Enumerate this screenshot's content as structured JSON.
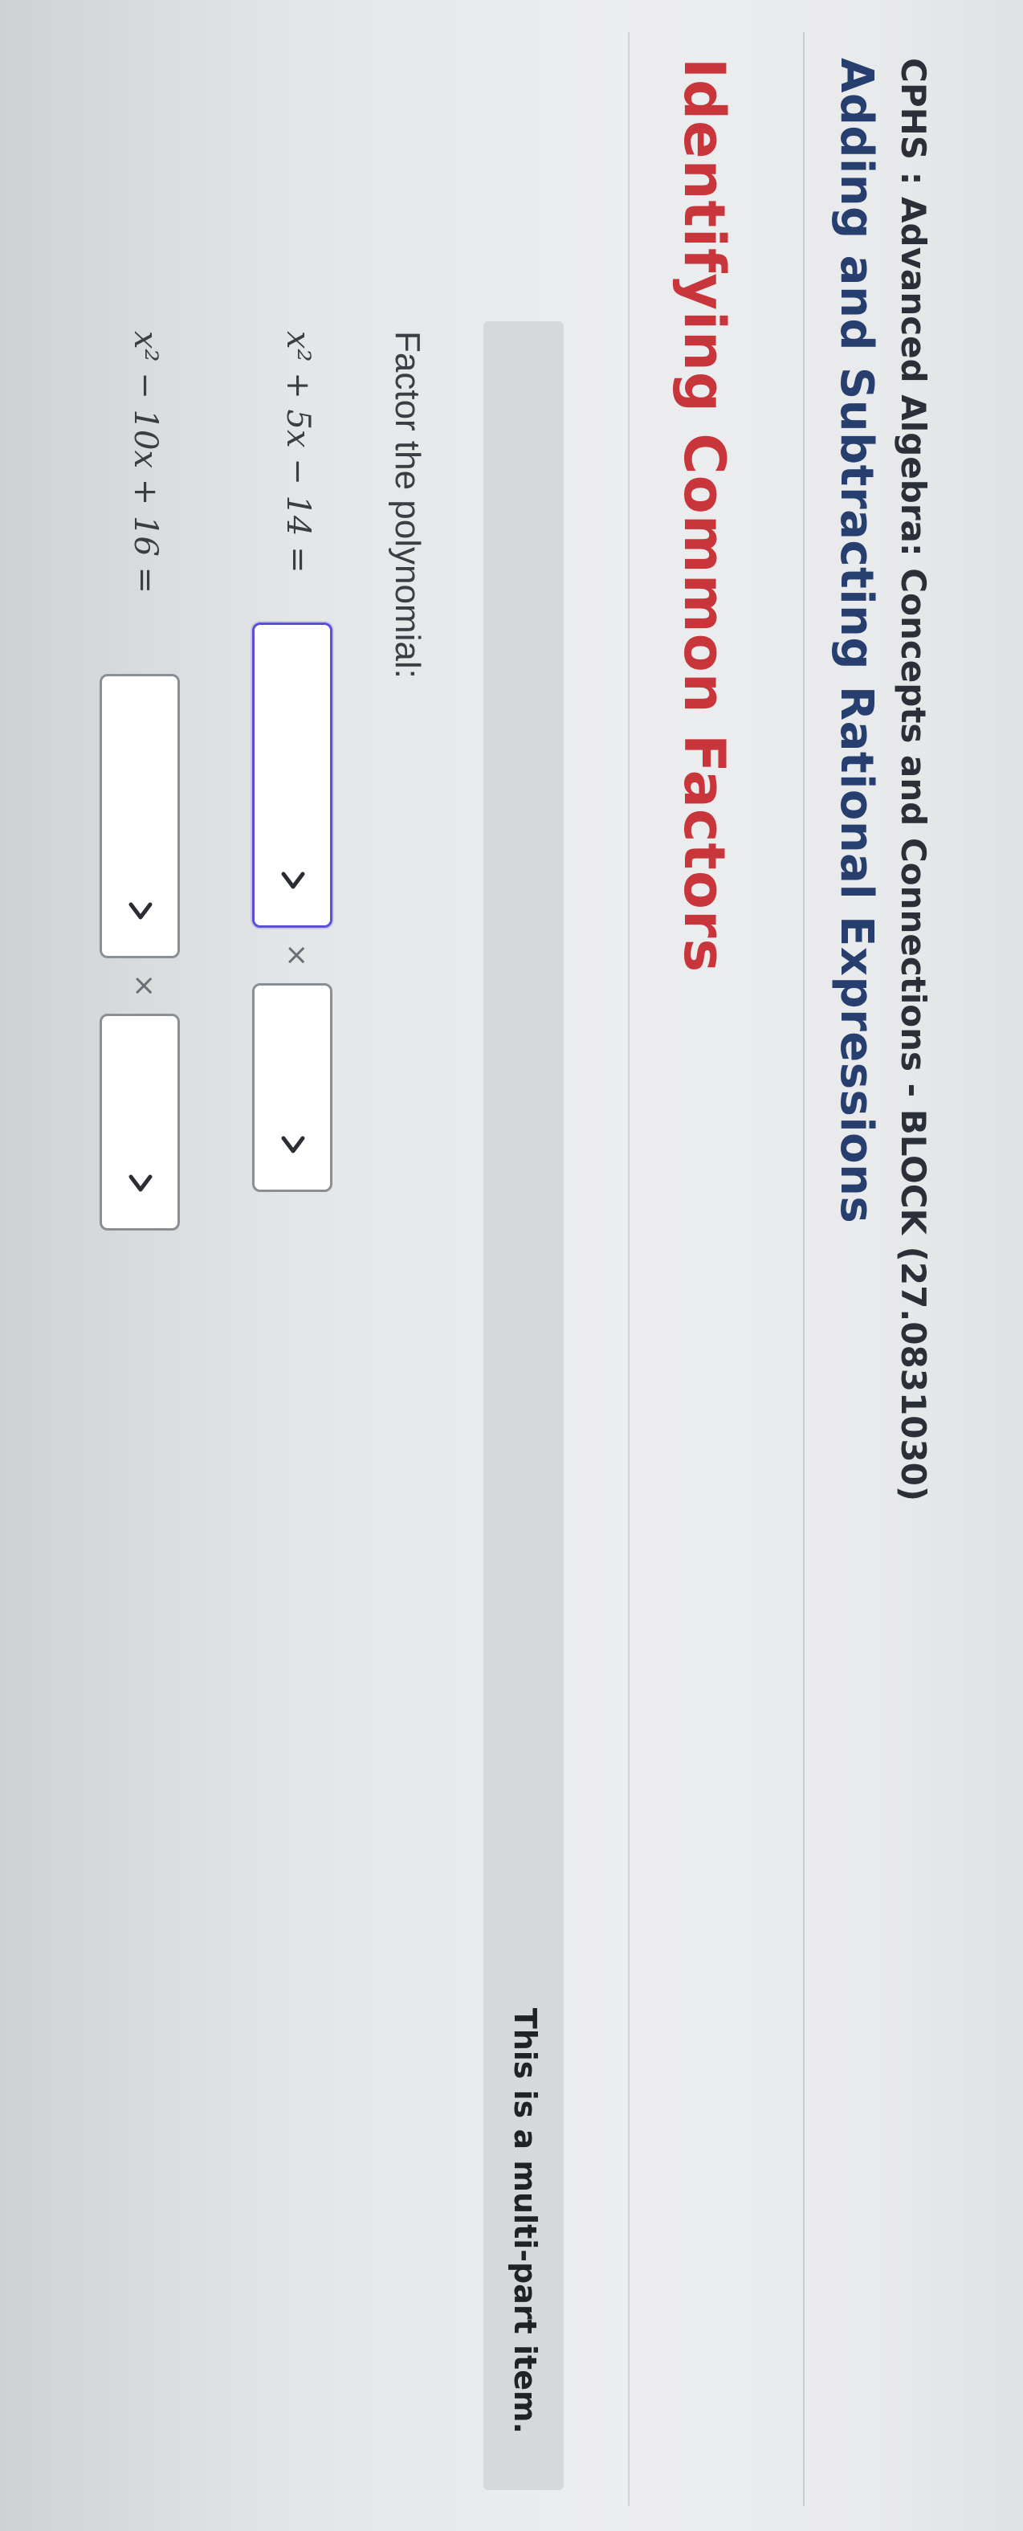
{
  "header": {
    "course_title": "CPHS : Advanced Algebra: Concepts and Connections - BLOCK (27.0831030)",
    "lesson_title": "Adding and Subtracting Rational Expressions"
  },
  "section": {
    "title": "Identifying Common Factors"
  },
  "banner": {
    "text": "This is a multi-part item."
  },
  "question": {
    "prompt": "Factor the polynomial:",
    "times_symbol": "×",
    "items": [
      {
        "equation": "x² + 5x − 14 ="
      },
      {
        "equation": "x² − 10x + 16 ="
      }
    ]
  },
  "colors": {
    "section_title": "#c8353a",
    "lesson_title": "#263f6e",
    "focus_border": "#5b4fd6"
  },
  "icons": {
    "dropdown": "chevron-down-icon"
  }
}
